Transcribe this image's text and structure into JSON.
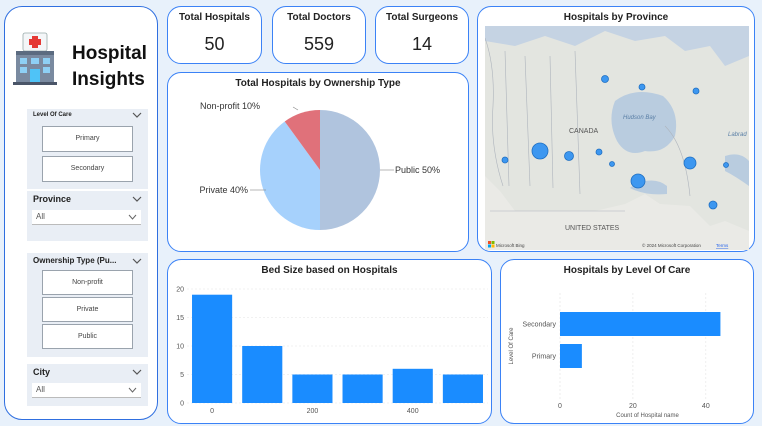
{
  "app": {
    "title_line1": "Hospital",
    "title_line2": "Insights"
  },
  "filters": {
    "level_of_care": {
      "title": "Level Of Care",
      "options": [
        "Primary",
        "Secondary"
      ]
    },
    "province": {
      "title": "Province",
      "selected": "All"
    },
    "ownership": {
      "title": "Ownership Type (Pu...",
      "options": [
        "Non-profit",
        "Private",
        "Public"
      ]
    },
    "city": {
      "title": "City",
      "selected": "All"
    }
  },
  "kpis": [
    {
      "title": "Total Hospitals",
      "value": "50"
    },
    {
      "title": "Total Doctors",
      "value": "559"
    },
    {
      "title": "Total Surgeons",
      "value": "14"
    }
  ],
  "map": {
    "title": "Hospitals by Province",
    "country_label": "CANADA",
    "us_label": "UNITED STATES",
    "bay_label": "Hudson Bay",
    "labrador_label": "Labrad",
    "copyright": "© 2024 Microsoft Corporation",
    "terms": "Terms",
    "brand": "Microsoft Bing"
  },
  "chart_data": [
    {
      "type": "pie",
      "title": "Total Hospitals by Ownership Type",
      "slices": [
        {
          "label": "Public",
          "value": 50,
          "display": "Public 50%",
          "color": "#b0c4de"
        },
        {
          "label": "Private",
          "value": 40,
          "display": "Private 40%",
          "color": "#a6d1fc"
        },
        {
          "label": "Non-profit",
          "value": 10,
          "display": "Non-profit 10%",
          "color": "#e0717a"
        }
      ]
    },
    {
      "type": "bar",
      "title": "Bed Size based on Hospitals",
      "values": [
        19,
        10,
        5,
        5,
        6,
        5
      ],
      "x_ticks": [
        {
          "label": "0",
          "pos": 0
        },
        {
          "label": "200",
          "pos": 2
        },
        {
          "label": "400",
          "pos": 4
        }
      ],
      "yticks": [
        0,
        5,
        10,
        15,
        20
      ],
      "ylim": [
        0,
        20
      ],
      "color": "#1a8cff"
    },
    {
      "type": "bar",
      "orientation": "horizontal",
      "title": "Hospitals by Level Of Care",
      "categories": [
        "Secondary",
        "Primary"
      ],
      "values": [
        44,
        6
      ],
      "xlabel": "Count of Hospital name",
      "ylabel": "Level Of Care",
      "xticks": [
        0,
        20,
        40
      ],
      "xlim": [
        0,
        48
      ],
      "color": "#1a8cff"
    }
  ]
}
